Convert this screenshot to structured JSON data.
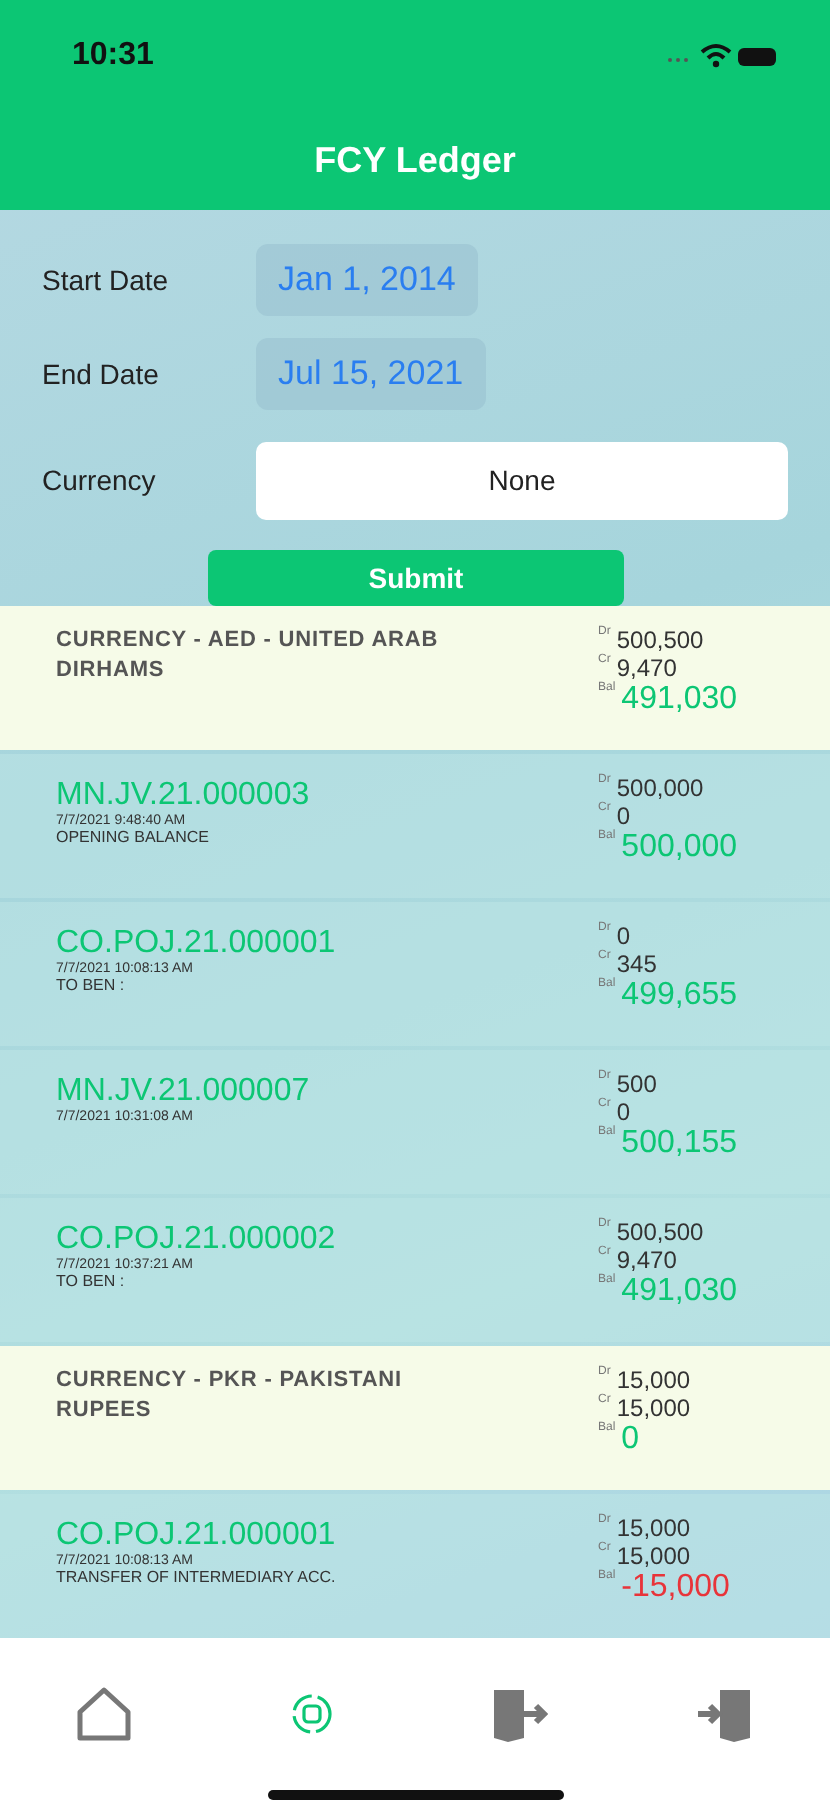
{
  "status_bar": {
    "time": "10:31"
  },
  "title": "FCY Ledger",
  "form": {
    "start_date": {
      "label": "Start Date",
      "value": "Jan 1, 2014"
    },
    "end_date": {
      "label": "End Date",
      "value": "Jul 15, 2021"
    },
    "currency": {
      "label": "Currency",
      "value": "None"
    },
    "submit": "Submit"
  },
  "entries": [
    {
      "kind": "currency",
      "title": "CURRENCY - AED - UNITED ARAB DIRHAMS",
      "dr_label": "Dr",
      "dr": "500,500",
      "cr_label": "Cr",
      "cr": "9,470",
      "bal_label": "Bal",
      "bal": "491,030",
      "negative": false
    },
    {
      "kind": "voucher",
      "title": "MN.JV.21.000003",
      "time": "7/7/2021 9:48:40 AM",
      "note": "OPENING BALANCE",
      "dr_label": "Dr",
      "dr": "500,000",
      "cr_label": "Cr",
      "cr": "0",
      "bal_label": "Bal",
      "bal": "500,000",
      "negative": false
    },
    {
      "kind": "voucher",
      "title": "CO.POJ.21.000001",
      "time": "7/7/2021 10:08:13 AM",
      "note": "TO BEN :",
      "dr_label": "Dr",
      "dr": "0",
      "cr_label": "Cr",
      "cr": "345",
      "bal_label": "Bal",
      "bal": "499,655",
      "negative": false
    },
    {
      "kind": "voucher",
      "title": "MN.JV.21.000007",
      "time": "7/7/2021 10:31:08 AM",
      "dr_label": "Dr",
      "dr": "500",
      "cr_label": "Cr",
      "cr": "0",
      "bal_label": "Bal",
      "bal": "500,155",
      "negative": false
    },
    {
      "kind": "voucher",
      "title": "CO.POJ.21.000002",
      "time": "7/7/2021 10:37:21 AM",
      "note": "TO BEN :",
      "dr_label": "Dr",
      "dr": "500,500",
      "cr_label": "Cr",
      "cr": "9,470",
      "bal_label": "Bal",
      "bal": "491,030",
      "negative": false
    },
    {
      "kind": "currency",
      "title": "CURRENCY - PKR - PAKISTANI RUPEES",
      "dr_label": "Dr",
      "dr": "15,000",
      "cr_label": "Cr",
      "cr": "15,000",
      "bal_label": "Bal",
      "bal": "0",
      "negative": false
    },
    {
      "kind": "voucher",
      "title": "CO.POJ.21.000001",
      "time": "7/7/2021 10:08:13 AM",
      "note": "TRANSFER OF INTERMEDIARY ACC.",
      "dr_label": "Dr",
      "dr": "15,000",
      "cr_label": "Cr",
      "cr": "15,000",
      "bal_label": "Bal",
      "bal": "-15,000",
      "negative": true
    }
  ],
  "tab_bar": [
    {
      "kind": "home",
      "selected": false
    },
    {
      "kind": "ledger",
      "selected": true
    },
    {
      "kind": "logout",
      "selected": false
    },
    {
      "kind": "login",
      "selected": false
    }
  ]
}
